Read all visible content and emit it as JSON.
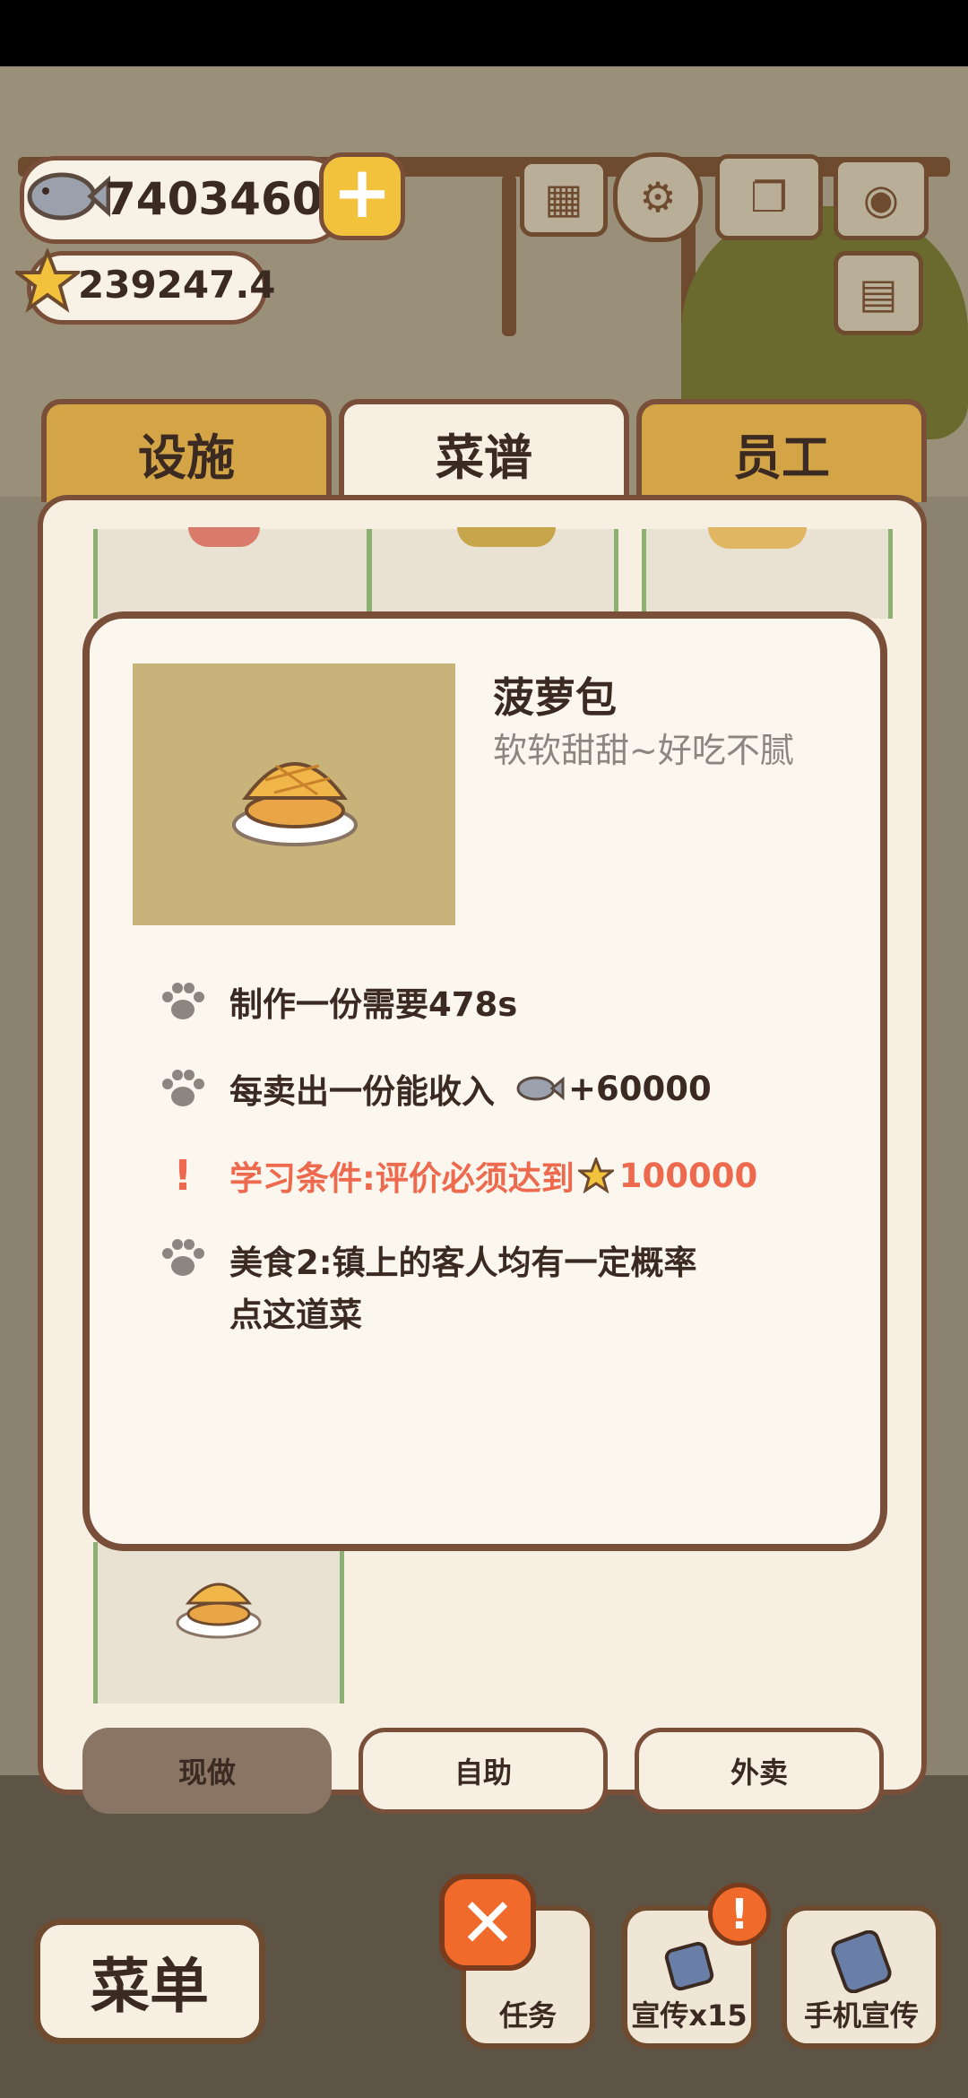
{
  "resources": {
    "fish_coins": "7403460",
    "stars": "239247.4"
  },
  "tabs": [
    {
      "label": "设施",
      "active": false
    },
    {
      "label": "菜谱",
      "active": true
    },
    {
      "label": "员工",
      "active": false
    }
  ],
  "recipe_detail": {
    "name": "菠萝包",
    "description": "软软甜甜~好吃不腻",
    "rows": [
      {
        "text": "制作一份需要478s",
        "icon": "paw-icon"
      },
      {
        "text_prefix": "每卖出一份能收入",
        "value": "+60000",
        "icon": "paw-icon"
      },
      {
        "text_prefix": "学习条件:评价必须达到",
        "value": "100000",
        "icon": "exclamation-icon"
      },
      {
        "line1": "美食2:镇上的客人均有一定概率",
        "line2": "点这道菜",
        "icon": "paw-icon"
      }
    ]
  },
  "mode_buttons": [
    {
      "label": "现做",
      "active": true
    },
    {
      "label": "自助",
      "active": false
    },
    {
      "label": "外卖",
      "active": false
    }
  ],
  "bottom_bar": {
    "menu_label": "菜单",
    "task_label": "任务",
    "promo_label": "宣传x15",
    "phone_promo_label": "手机宣传"
  },
  "colors": {
    "panel_border": "#7a4f3a",
    "tab_inactive": "#d4a546",
    "warning_text": "#ee6a4e",
    "close_button": "#f06a2c"
  }
}
